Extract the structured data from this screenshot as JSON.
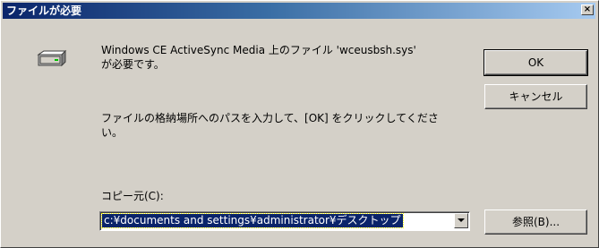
{
  "dialog": {
    "title": "ファイルが必要",
    "close_glyph": "×",
    "message_line1": "Windows CE ActiveSync Media 上のファイル 'wceusbsh.sys'",
    "message_line2": "が必要です。",
    "instruction_line1": "ファイルの格納場所へのパスを入力して、[OK] をクリックしてくださ",
    "instruction_line2": "い。",
    "copy_from_label": "コピー元(C):",
    "copy_from_value": "c:¥documents and settings¥administrator¥デスクトップ",
    "ok_label": "OK",
    "cancel_label": "キャンセル",
    "browse_label": "参照(B)..."
  },
  "icons": {
    "drive": "drive-icon",
    "close": "close-icon",
    "dropdown": "chevron-down-icon"
  },
  "colors": {
    "titlebar_start": "#0a246a",
    "titlebar_end": "#a6caf0",
    "dialog_face": "#d4d0c8",
    "selection": "#0a246a"
  }
}
